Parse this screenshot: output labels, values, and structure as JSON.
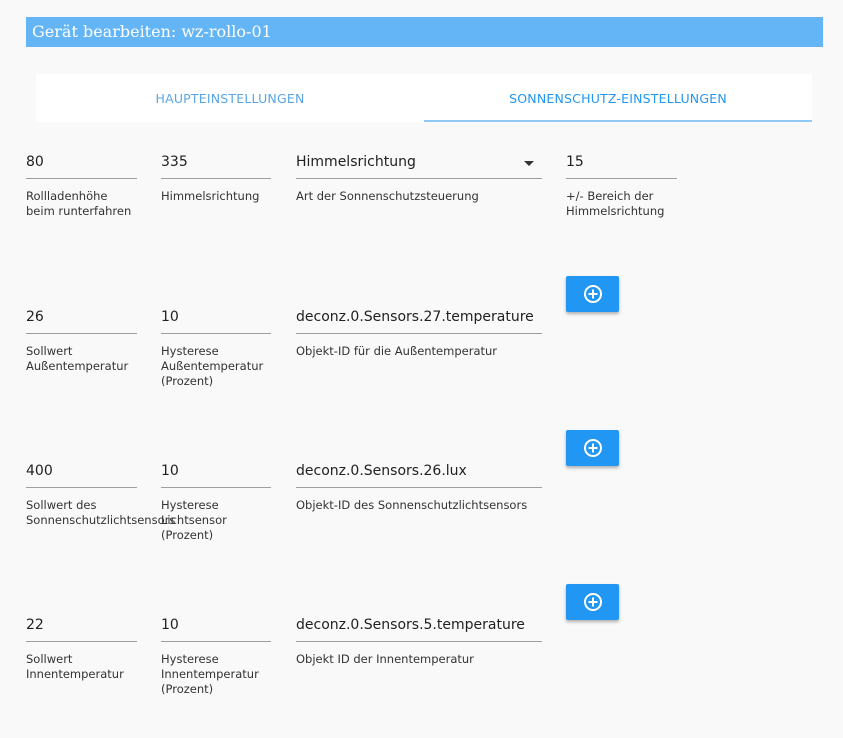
{
  "dialog": {
    "title": "Gerät bearbeiten: wz-rollo-01"
  },
  "tabs": [
    {
      "label": "HAUPTEINSTELLUNGEN"
    },
    {
      "label": "SONNENSCHUTZ-EINSTELLUNGEN"
    }
  ],
  "row1": {
    "height": {
      "value": "80",
      "label": "Rollladenhöhe beim runterfahren"
    },
    "direction": {
      "value": "335",
      "label": "Himmelsrichtung"
    },
    "control_type": {
      "value": "Himmelsrichtung",
      "label": "Art der Sonnenschutzsteuerung"
    },
    "range": {
      "value": "15",
      "label": "+/- Bereich der Himmelsrichtung"
    }
  },
  "row2": {
    "setpoint": {
      "value": "26",
      "label": "Sollwert Außentemperatur"
    },
    "hysteresis": {
      "value": "10",
      "label": "Hysterese Außentemperatur (Prozent)"
    },
    "object_id": {
      "value": "deconz.0.Sensors.27.temperature",
      "label": "Objekt-ID für die Außentemperatur"
    }
  },
  "row3": {
    "setpoint": {
      "value": "400",
      "label": "Sollwert des Sonnenschutzlichtsensors"
    },
    "hysteresis": {
      "value": "10",
      "label": "Hysterese Lichtsensor (Prozent)"
    },
    "object_id": {
      "value": "deconz.0.Sensors.26.lux",
      "label": "Objekt-ID des Sonnenschutzlichtsensors"
    }
  },
  "row4": {
    "setpoint": {
      "value": "22",
      "label": "Sollwert Innentemperatur"
    },
    "hysteresis": {
      "value": "10",
      "label": "Hysterese Innentemperatur (Prozent)"
    },
    "object_id": {
      "value": "deconz.0.Sensors.5.temperature",
      "label": "Objekt ID der Innentemperatur"
    }
  },
  "icons": {
    "add": "add-circle-icon"
  },
  "colors": {
    "accent": "#2196f3",
    "title_bar": "#64b5f6"
  }
}
